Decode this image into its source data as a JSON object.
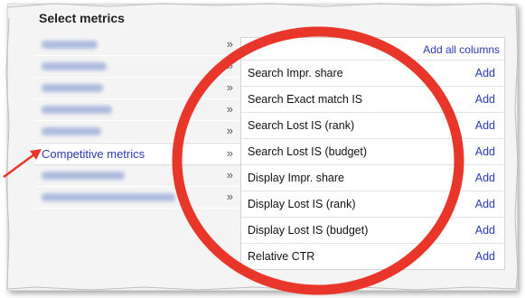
{
  "dialog": {
    "title": "Select metrics"
  },
  "categories": {
    "active_label": "Competitive metrics",
    "chevron": "»"
  },
  "metrics": {
    "add_all_label": "Add all columns",
    "add_label": "Add",
    "items": [
      {
        "label": "Search Impr. share"
      },
      {
        "label": "Search Exact match IS"
      },
      {
        "label": "Search Lost IS (rank)"
      },
      {
        "label": "Search Lost IS (budget)"
      },
      {
        "label": "Display Impr. share"
      },
      {
        "label": "Display Lost IS (rank)"
      },
      {
        "label": "Display Lost IS (budget)"
      },
      {
        "label": "Relative CTR"
      }
    ]
  },
  "annotation": {
    "color": "#e8372a"
  }
}
